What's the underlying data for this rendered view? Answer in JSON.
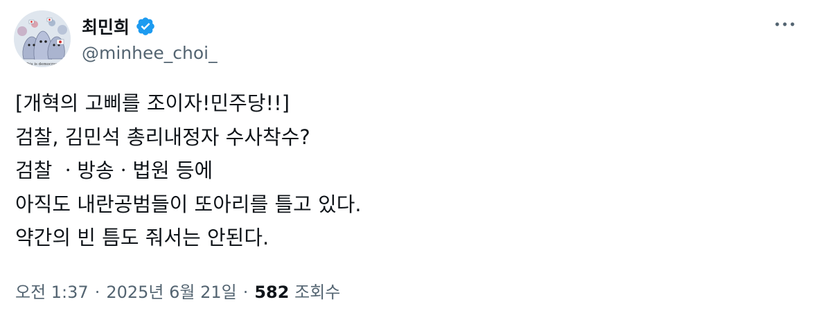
{
  "author": {
    "display_name": "최민희",
    "handle": "@minhee_choi_",
    "verified": true,
    "avatar_caption": "This is democracy"
  },
  "menu": {
    "more_icon": "more-horizontal-icon"
  },
  "tweet": {
    "lines": [
      "[개혁의 고삐를 조이자!민주당!!]",
      "검찰, 김민석 총리내정자 수사착수?",
      "검찰 ㆍ방송ㆍ법원 등에",
      "아직도 내란공범들이 또아리를 틀고 있다.",
      "약간의 빈 틈도 줘서는 안된다."
    ]
  },
  "meta": {
    "time": "오전 1:37",
    "date": "2025년 6월 21일",
    "separator": "·",
    "views_count": "582",
    "views_label": "조회수"
  },
  "colors": {
    "text_primary": "#0f1419",
    "text_secondary": "#536471",
    "verified_blue": "#1d9bf0"
  }
}
